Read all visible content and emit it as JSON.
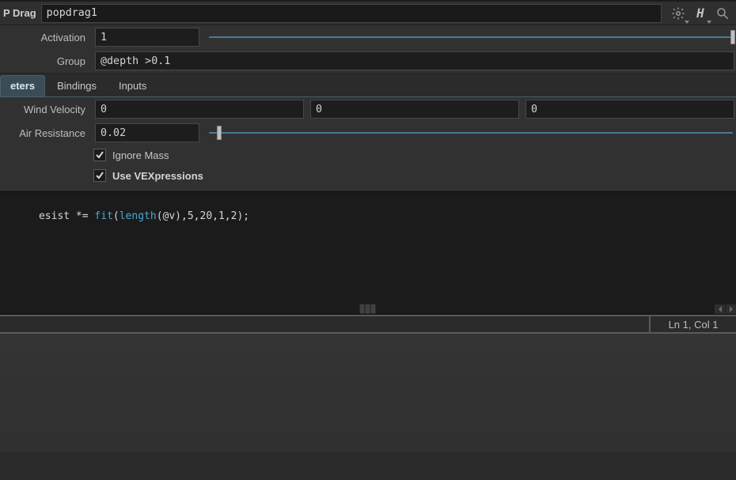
{
  "header": {
    "op_type_suffix": "P Drag",
    "node_name": "popdrag1"
  },
  "toolbar_icons": {
    "gear": "gear-icon",
    "h": "H",
    "search": "search-icon"
  },
  "parms": {
    "activation_label": "Activation",
    "activation_value": "1",
    "group_label": "Group",
    "group_value": "@depth >0.1"
  },
  "tabs": {
    "items": [
      {
        "label": "eters",
        "active": true
      },
      {
        "label": "Bindings",
        "active": false
      },
      {
        "label": "Inputs",
        "active": false
      }
    ]
  },
  "wind": {
    "label": "Wind Velocity",
    "x": "0",
    "y": "0",
    "z": "0"
  },
  "air": {
    "label": "Air Resistance",
    "value": "0.02",
    "slider_pct": 2
  },
  "checks": {
    "ignore_mass_label": "Ignore Mass",
    "ignore_mass_checked": true,
    "use_vex_label": "Use VEXpressions",
    "use_vex_checked": true
  },
  "vex": {
    "line_prefix": "esist *= ",
    "func1": "fit",
    "paren_open": "(",
    "func2": "length",
    "rest": "(@v),5,20,1,2);"
  },
  "status": {
    "cursor": "Ln 1, Col 1"
  }
}
